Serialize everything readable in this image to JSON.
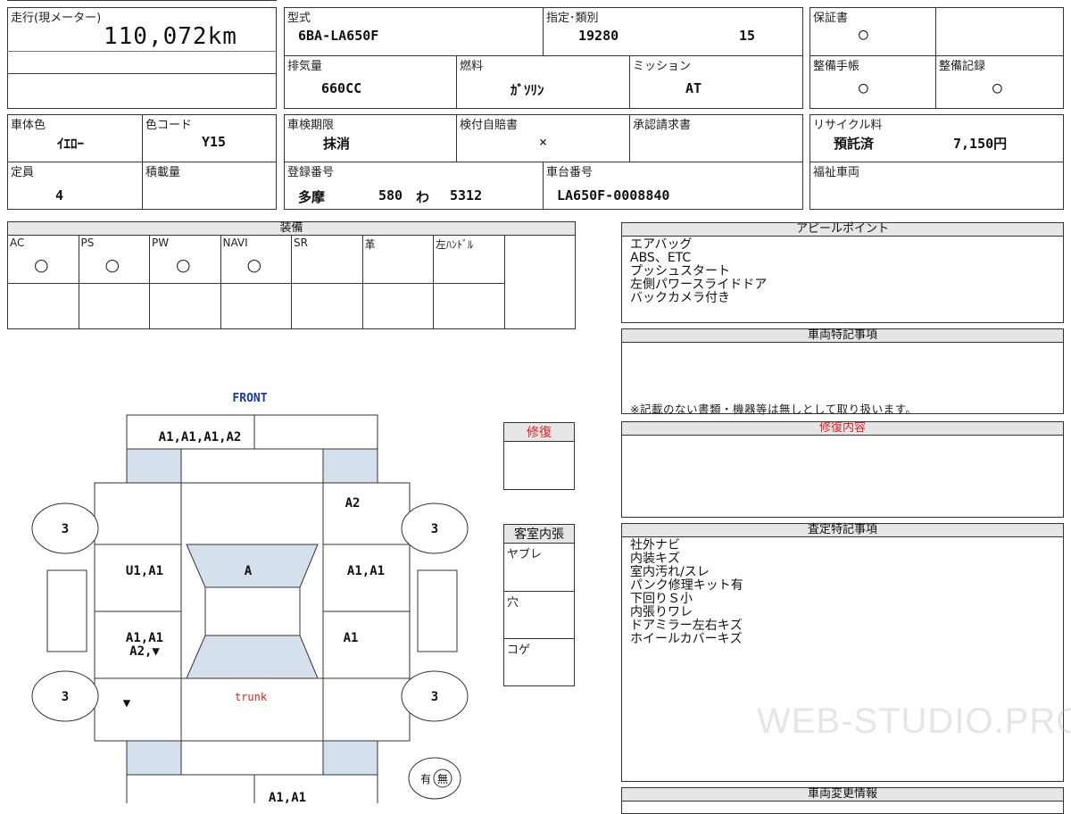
{
  "mileage": {
    "label": "走行(現メーター)",
    "value": "110,072km"
  },
  "model": {
    "label": "型式",
    "value": "6BA-LA650F"
  },
  "designation": {
    "label": "指定･類別",
    "value1": "19280",
    "value2": "15"
  },
  "warranty": {
    "label": "保証書",
    "value": "○"
  },
  "displacement": {
    "label": "排気量",
    "value": "660CC"
  },
  "fuel": {
    "label": "燃料",
    "value": "ｶﾞｿﾘﾝ"
  },
  "transmission": {
    "label": "ミッション",
    "value": "AT"
  },
  "maintenance_book": {
    "label": "整備手帳",
    "value": "○"
  },
  "maintenance_record": {
    "label": "整備記録",
    "value": "○"
  },
  "body_color": {
    "label": "車体色",
    "value": "ｲｴﾛｰ"
  },
  "color_code": {
    "label": "色コード",
    "value": "Y15"
  },
  "inspection": {
    "label": "車検期限",
    "value": "抹消"
  },
  "insurance": {
    "label": "検付自賠書",
    "value": "×"
  },
  "approval": {
    "label": "承認請求書"
  },
  "recycle": {
    "label": "リサイクル料",
    "value1": "預託済",
    "value2": "7,150円"
  },
  "capacity": {
    "label": "定員",
    "value": "4"
  },
  "load": {
    "label": "積載量"
  },
  "registration": {
    "label": "登録番号",
    "area": "多摩",
    "num": "580",
    "kana": "わ",
    "serial": "5312"
  },
  "chassis": {
    "label": "車台番号",
    "value": "LA650F-0008840"
  },
  "welfare": {
    "label": "福祉車両"
  },
  "equipment": {
    "title": "装備",
    "items": [
      {
        "label": "AC",
        "mark": "○"
      },
      {
        "label": "PS",
        "mark": "○"
      },
      {
        "label": "PW",
        "mark": "○"
      },
      {
        "label": "NAVI",
        "mark": "○"
      },
      {
        "label": "SR",
        "mark": ""
      },
      {
        "label": "革",
        "mark": ""
      },
      {
        "label": "左ﾊﾝﾄﾞﾙ",
        "mark": ""
      }
    ]
  },
  "appeal": {
    "title": "アピールポイント",
    "lines": [
      "エアバッグ",
      "ABS、ETC",
      "プッシュスタート",
      "左側パワースライドドア",
      "バックカメラ付き"
    ]
  },
  "vehicle_notes": {
    "title": "車両特記事項",
    "footer": "※記載のない書類・機器等は無しとして取り扱います。"
  },
  "repair_content": {
    "title": "修復内容"
  },
  "assessment": {
    "title": "査定特記事項",
    "lines": [
      "社外ナビ",
      "内装キズ",
      "室内汚れ/スレ",
      "パンク修理キット有",
      "下回りＳ小",
      "内張りワレ",
      "ドアミラー左右キズ",
      "ホイールカバーキズ"
    ]
  },
  "change_info": {
    "title": "車両変更情報"
  },
  "repair_flag": {
    "title": "修復"
  },
  "interior": {
    "title": "客室内張",
    "items": [
      "ヤブレ",
      "穴",
      "コゲ"
    ]
  },
  "diagram": {
    "front": "FRONT",
    "trunk": "trunk",
    "front_bumper": "A1,A1,A1,A2",
    "front_right_fender": "A2",
    "left_front_door": "U1,A1",
    "roof": "A",
    "right_front_door": "A1,A1",
    "left_rear_door": "A1,A1\nA2,▼",
    "right_rear_door": "A1",
    "left_quarter": "▼",
    "rear_bumper": "A1,A1",
    "tire_fl": "3",
    "tire_fr": "3",
    "tire_rl": "3",
    "tire_rr": "3",
    "spare_ari": "有",
    "spare_nashi": "無"
  },
  "watermark": "WEB-STUDIO.PRO"
}
